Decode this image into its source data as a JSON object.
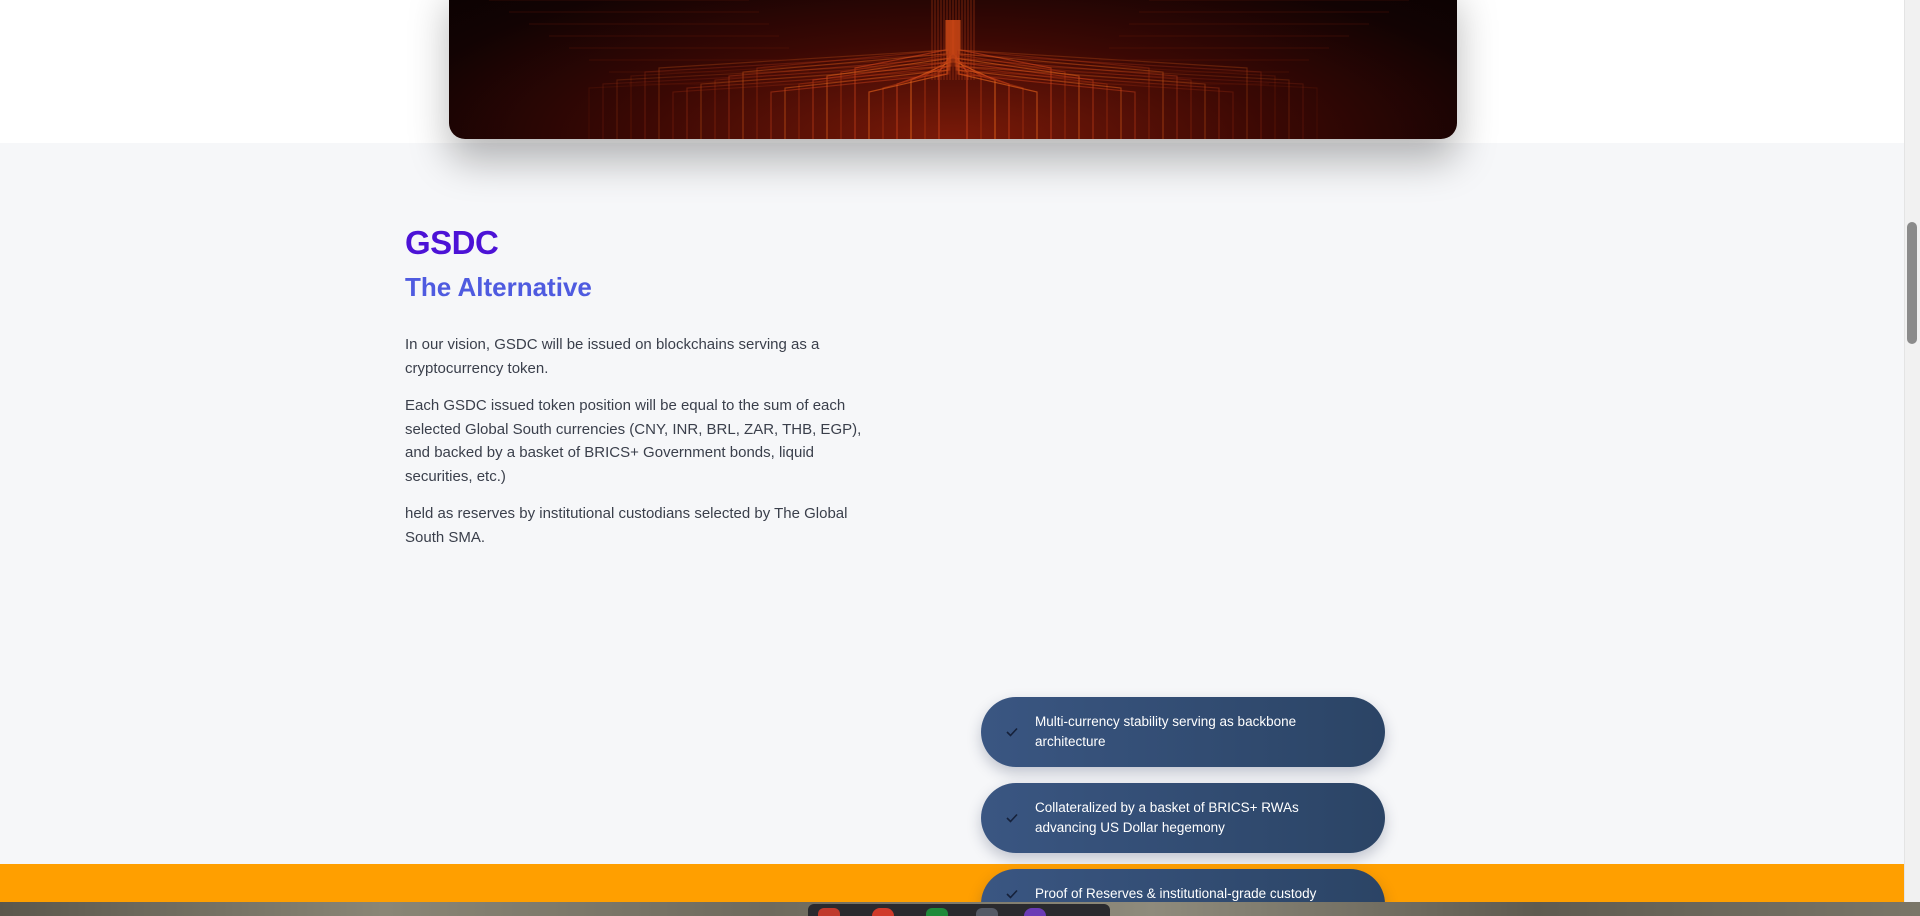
{
  "hero": {
    "image_icon": "circuit-board-image"
  },
  "section": {
    "title": "GSDC",
    "subtitle": "The Alternative",
    "paragraphs": [
      "In our vision, GSDC will be issued on blockchains serving as a cryptocurrency token.",
      "Each GSDC issued token position will be equal to the sum of each selected Global South currencies (CNY, INR, BRL, ZAR, THB, EGP), and backed by a basket of BRICS+ Government bonds, liquid securities, etc.)",
      "held as reserves by institutional custodians selected by The Global South SMA."
    ]
  },
  "features": [
    {
      "icon": "check-icon",
      "label": "Multi-currency stability serving as backbone architecture"
    },
    {
      "icon": "check-icon",
      "label": "Collateralized by a basket of BRICS+ RWAs advancing US Dollar hegemony"
    },
    {
      "icon": "check-icon",
      "label": "Proof of Reserves & institutional-grade custody"
    }
  ],
  "colors": {
    "title": "#4c12d6",
    "subtitle": "#4f5be0",
    "pill": "#2b4465",
    "banner": "#ff9f00",
    "section_bg": "#f6f7f9"
  }
}
